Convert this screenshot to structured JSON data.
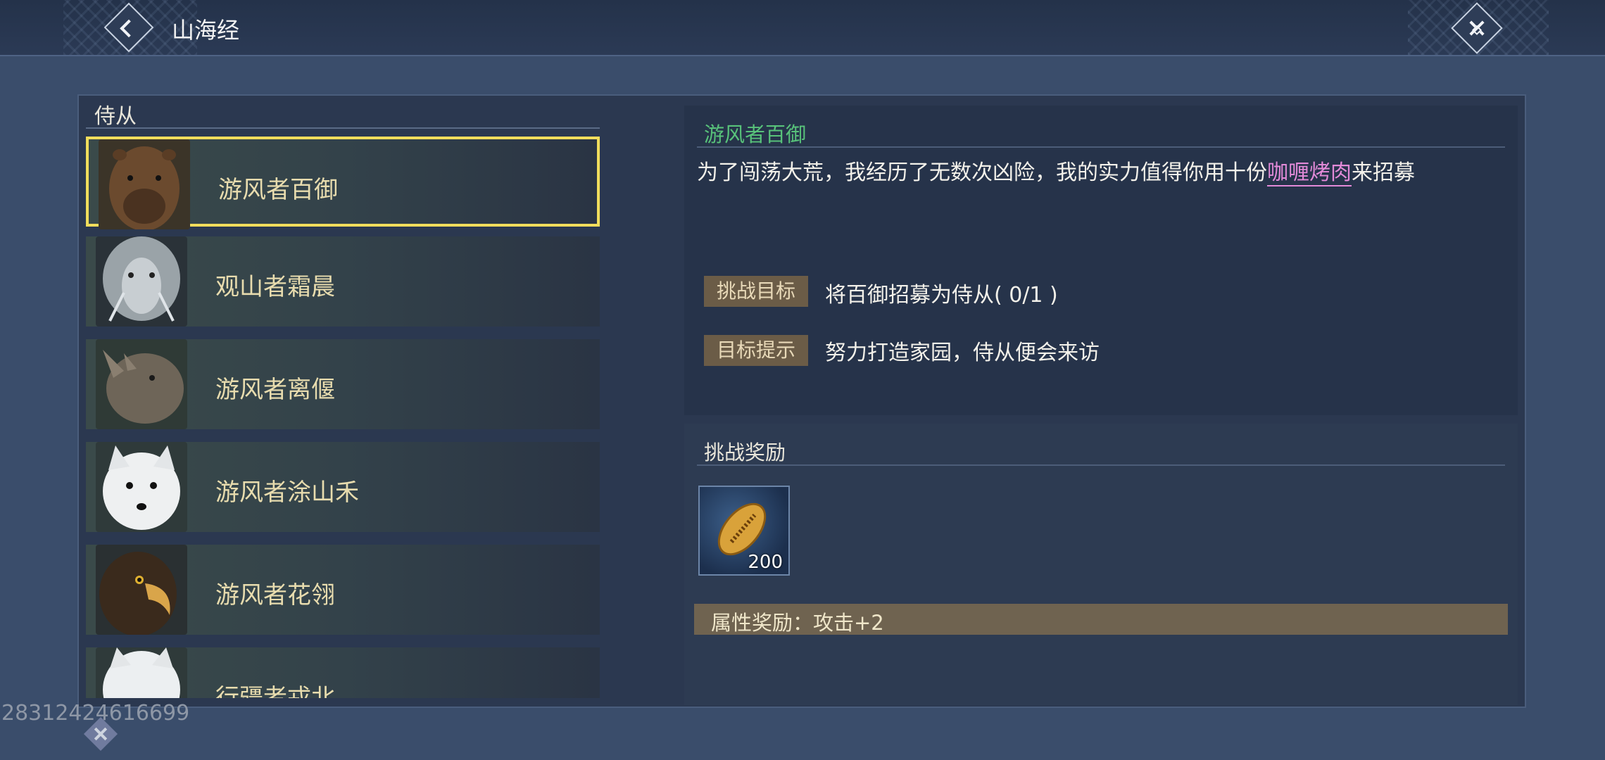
{
  "header": {
    "title": "山海经"
  },
  "left": {
    "section_label": "侍从",
    "items": [
      {
        "name": "游风者百御",
        "portrait_icon": "capybara-portrait",
        "selected": true
      },
      {
        "name": "观山者霜晨",
        "portrait_icon": "white-ape-portrait",
        "selected": false
      },
      {
        "name": "游风者离偃",
        "portrait_icon": "rhino-portrait",
        "selected": false
      },
      {
        "name": "游风者涂山禾",
        "portrait_icon": "white-fox-portrait",
        "selected": false
      },
      {
        "name": "游风者花翎",
        "portrait_icon": "eagle-portrait",
        "selected": false
      },
      {
        "name": "行疆者戎北",
        "portrait_icon": "white-beast-portrait",
        "selected": false
      }
    ]
  },
  "detail": {
    "npc_name": "游风者百御",
    "dialog_before": "为了闯荡大荒，我经历了无数次凶险，我的实力值得你用十份",
    "dialog_highlight": "咖喱烤肉",
    "dialog_after": "来招募",
    "challenge_target_label": "挑战目标",
    "challenge_target_text": "将百御招募为侍从( 0/1 )",
    "target_hint_label": "目标提示",
    "target_hint_text": "努力打造家园，侍从便会来访"
  },
  "reward": {
    "title": "挑战奖励",
    "item_icon": "gold-shell-coin-icon",
    "item_count": "200",
    "attr_text": "属性奖励：攻击+2"
  },
  "footer": {
    "uid": "28312424616699"
  },
  "colors": {
    "accent_select": "#f1dd5c",
    "npc_name": "#58c27a",
    "highlight": "#e28ad8"
  }
}
